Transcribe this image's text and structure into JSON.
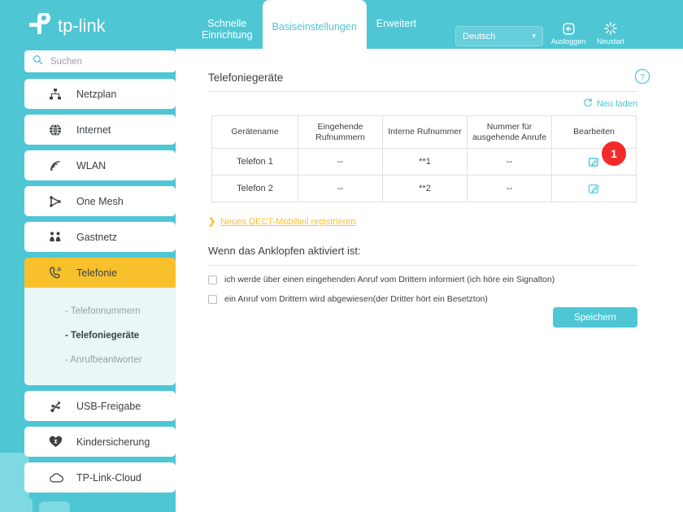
{
  "brand": {
    "name": "tp-link",
    "logo_icon": "tp-link-logo"
  },
  "header": {
    "tabs": [
      {
        "label": "Schnelle\nEinrichtung",
        "active": false
      },
      {
        "label": "Basiseinstellungen",
        "active": true
      },
      {
        "label": "Erweitert",
        "active": false
      }
    ],
    "language": {
      "value": "Deutsch",
      "chevron": "▾"
    },
    "logout": {
      "label": "Ausloggen",
      "icon": "logout-icon"
    },
    "reboot": {
      "label": "Neustart",
      "icon": "reboot-icon"
    }
  },
  "sidebar": {
    "search": {
      "placeholder": "Suchen",
      "icon": "search-icon"
    },
    "items": [
      {
        "label": "Netzplan",
        "icon": "network-map-icon"
      },
      {
        "label": "Internet",
        "icon": "globe-icon"
      },
      {
        "label": "WLAN",
        "icon": "wifi-icon"
      },
      {
        "label": "One Mesh",
        "icon": "mesh-icon"
      },
      {
        "label": "Gastnetz",
        "icon": "guest-network-icon"
      },
      {
        "label": "Telefonie",
        "icon": "phone-icon",
        "selected": true
      },
      {
        "label": "USB-Freigabe",
        "icon": "usb-icon"
      },
      {
        "label": "Kindersicherung",
        "icon": "parental-control-icon"
      },
      {
        "label": "TP-Link-Cloud",
        "icon": "cloud-icon"
      }
    ],
    "submenu": [
      {
        "label": "- Telefonnummern",
        "active": false
      },
      {
        "label": "- Telefoniegeräte",
        "active": true
      },
      {
        "label": "- Anrufbeantworter",
        "active": false
      }
    ]
  },
  "main": {
    "panel_title": "Telefoniegeräte",
    "help_icon": "help-icon",
    "reload": {
      "label": "Neu laden",
      "icon": "refresh-icon"
    },
    "table": {
      "columns": [
        "Gerätename",
        "Eingehende\nRufnummern",
        "Interne Rufnummer",
        "Nummer für\nausgehende Anrufe",
        "Bearbeiten"
      ],
      "rows": [
        {
          "name": "Telefon 1",
          "incoming": "--",
          "internal": "**1",
          "outgoing": "--",
          "edit_icon": "edit-icon"
        },
        {
          "name": "Telefon 2",
          "incoming": "--",
          "internal": "**2",
          "outgoing": "--",
          "edit_icon": "edit-icon"
        }
      ]
    },
    "badge": {
      "value": "1",
      "color": "#f42a2a"
    },
    "dect_link": {
      "arrow": "❯",
      "label": "Neues DECT-Mobilteil registrieren"
    },
    "section_title": "Wenn das Anklopfen aktiviert ist:",
    "checkboxes": [
      {
        "label": "ich werde über einen eingehenden Anruf vom Drittern informiert (ich höre ein Signalton)",
        "checked": false
      },
      {
        "label": "ein Anruf vom Drittern wird abgewiesen(der Dritter hört ein Besetzton)",
        "checked": false
      }
    ],
    "save_label": "Speichern"
  },
  "colors": {
    "brand_teal": "#4ec6d4",
    "accent_yellow": "#f8c12c",
    "badge_red": "#f42a2a",
    "submenu_bg": "#e9f7f6"
  }
}
